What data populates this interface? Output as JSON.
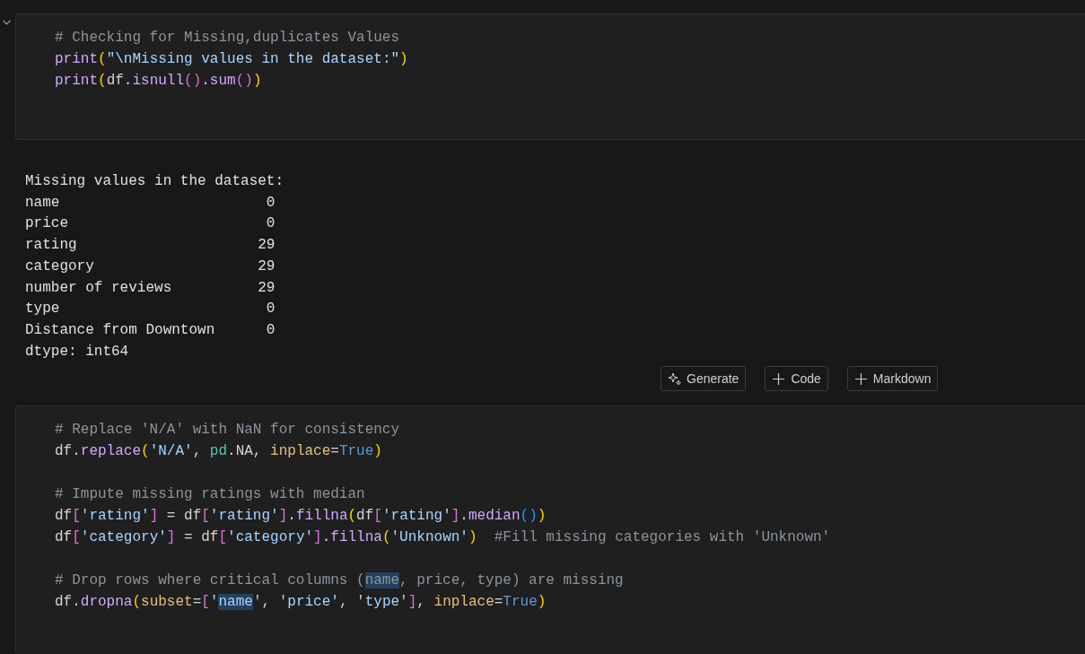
{
  "cells": [
    {
      "kind": "code",
      "lines": [
        {
          "tokens": [
            {
              "kind": "comment",
              "t": "# Checking for Missing,duplicates Values"
            }
          ]
        },
        {
          "tokens": [
            {
              "kind": "function",
              "t": "print"
            },
            {
              "kind": "paren",
              "t": "("
            },
            {
              "kind": "string",
              "t": "\"\\nMissing values in the dataset:\""
            },
            {
              "kind": "paren",
              "t": ")"
            }
          ]
        },
        {
          "tokens": [
            {
              "kind": "function",
              "t": "print"
            },
            {
              "kind": "paren",
              "t": "("
            },
            {
              "kind": "plain",
              "t": "df."
            },
            {
              "kind": "function",
              "t": "isnull"
            },
            {
              "kind": "bracket",
              "t": "()"
            },
            {
              "kind": "plain",
              "t": "."
            },
            {
              "kind": "function",
              "t": "sum"
            },
            {
              "kind": "bracket",
              "t": "()"
            },
            {
              "kind": "paren",
              "t": ")"
            }
          ]
        }
      ]
    },
    {
      "kind": "output",
      "lines": [
        "Missing values in the dataset:",
        "name                        0",
        "price                       0",
        "rating                     29",
        "category                   29",
        "number of reviews          29",
        "type                        0",
        "Distance from Downtown      0",
        "dtype: int64"
      ]
    },
    {
      "kind": "toolbar",
      "buttons": [
        {
          "kind": "generate",
          "label": "Generate"
        },
        {
          "kind": "add",
          "label": "Code"
        },
        {
          "kind": "add",
          "label": "Markdown"
        }
      ]
    },
    {
      "kind": "code",
      "lines": [
        {
          "tokens": [
            {
              "kind": "comment",
              "t": "# Replace 'N/A' with NaN for consistency"
            }
          ]
        },
        {
          "tokens": [
            {
              "kind": "plain",
              "t": "df."
            },
            {
              "kind": "function",
              "t": "replace"
            },
            {
              "kind": "paren",
              "t": "("
            },
            {
              "kind": "string",
              "t": "'N/A'"
            },
            {
              "kind": "plain",
              "t": ", "
            },
            {
              "kind": "module",
              "t": "pd"
            },
            {
              "kind": "plain",
              "t": ".NA, "
            },
            {
              "kind": "argument",
              "t": "inplace"
            },
            {
              "kind": "plain",
              "t": "="
            },
            {
              "kind": "keyword",
              "t": "True"
            },
            {
              "kind": "paren",
              "t": ")"
            }
          ]
        },
        {
          "blank_line_before": true,
          "tokens": [
            {
              "kind": "comment",
              "t": "# Impute missing ratings with median"
            }
          ]
        },
        {
          "tokens": [
            {
              "kind": "plain",
              "t": "df"
            },
            {
              "kind": "bracket",
              "t": "["
            },
            {
              "kind": "string",
              "t": "'rating'"
            },
            {
              "kind": "bracket",
              "t": "]"
            },
            {
              "kind": "plain",
              "t": " = df"
            },
            {
              "kind": "bracket",
              "t": "["
            },
            {
              "kind": "string",
              "t": "'rating'"
            },
            {
              "kind": "bracket",
              "t": "]"
            },
            {
              "kind": "plain",
              "t": "."
            },
            {
              "kind": "function",
              "t": "fillna"
            },
            {
              "kind": "paren",
              "t": "("
            },
            {
              "kind": "plain",
              "t": "df"
            },
            {
              "kind": "bracket",
              "t": "["
            },
            {
              "kind": "string",
              "t": "'rating'"
            },
            {
              "kind": "bracket",
              "t": "]"
            },
            {
              "kind": "plain",
              "t": "."
            },
            {
              "kind": "function",
              "t": "median"
            },
            {
              "kind": "inner",
              "t": "()"
            },
            {
              "kind": "paren",
              "t": ")"
            }
          ]
        },
        {
          "tokens": [
            {
              "kind": "plain",
              "t": "df"
            },
            {
              "kind": "bracket",
              "t": "["
            },
            {
              "kind": "string",
              "t": "'category'"
            },
            {
              "kind": "bracket",
              "t": "]"
            },
            {
              "kind": "plain",
              "t": " = df"
            },
            {
              "kind": "bracket",
              "t": "["
            },
            {
              "kind": "string",
              "t": "'category'"
            },
            {
              "kind": "bracket",
              "t": "]"
            },
            {
              "kind": "plain",
              "t": "."
            },
            {
              "kind": "function",
              "t": "fillna"
            },
            {
              "kind": "paren",
              "t": "("
            },
            {
              "kind": "string",
              "t": "'Unknown'"
            },
            {
              "kind": "paren",
              "t": ")"
            },
            {
              "kind": "comment",
              "t": "  #Fill missing categories with 'Unknown'"
            }
          ]
        },
        {
          "blank_line_before": true,
          "tokens": [
            {
              "kind": "comment",
              "t": "# Drop rows where critical columns ("
            },
            {
              "kind": "comment",
              "t": "name",
              "highlighted": true
            },
            {
              "kind": "comment",
              "t": ", price, type) are missing"
            }
          ]
        },
        {
          "tokens": [
            {
              "kind": "plain",
              "t": "df."
            },
            {
              "kind": "function",
              "t": "dropna"
            },
            {
              "kind": "paren",
              "t": "("
            },
            {
              "kind": "argument",
              "t": "subset"
            },
            {
              "kind": "plain",
              "t": "="
            },
            {
              "kind": "bracket",
              "t": "["
            },
            {
              "kind": "string",
              "t": "'"
            },
            {
              "kind": "string",
              "t": "name",
              "highlighted": true
            },
            {
              "kind": "string",
              "t": "'"
            },
            {
              "kind": "plain",
              "t": ", "
            },
            {
              "kind": "string",
              "t": "'price'"
            },
            {
              "kind": "plain",
              "t": ", "
            },
            {
              "kind": "string",
              "t": "'type'"
            },
            {
              "kind": "bracket",
              "t": "]"
            },
            {
              "kind": "plain",
              "t": ", "
            },
            {
              "kind": "argument",
              "t": "inplace"
            },
            {
              "kind": "plain",
              "t": "="
            },
            {
              "kind": "keyword",
              "t": "True"
            },
            {
              "kind": "paren",
              "t": ")"
            }
          ]
        }
      ]
    }
  ]
}
